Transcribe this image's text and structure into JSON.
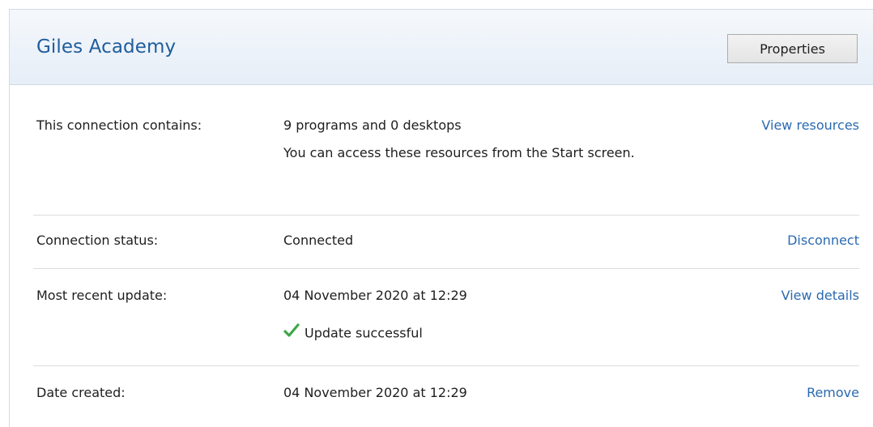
{
  "header": {
    "title": "Giles Academy",
    "properties_label": "Properties"
  },
  "rows": {
    "contains": {
      "label": "This connection contains:",
      "value": "9 programs and 0 desktops",
      "note": "You can access these resources from the Start screen.",
      "action": "View resources"
    },
    "status": {
      "label": "Connection status:",
      "value": "Connected",
      "action": "Disconnect"
    },
    "update": {
      "label": "Most recent update:",
      "value": "04 November 2020 at 12:29",
      "result": "Update successful",
      "action": "View details"
    },
    "created": {
      "label": "Date created:",
      "value": "04 November 2020 at 12:29",
      "action": "Remove"
    }
  },
  "colors": {
    "title": "#1f5d9c",
    "link": "#2a6ab0",
    "success": "#3fa64a"
  },
  "icons": {
    "success": "checkmark-icon"
  }
}
